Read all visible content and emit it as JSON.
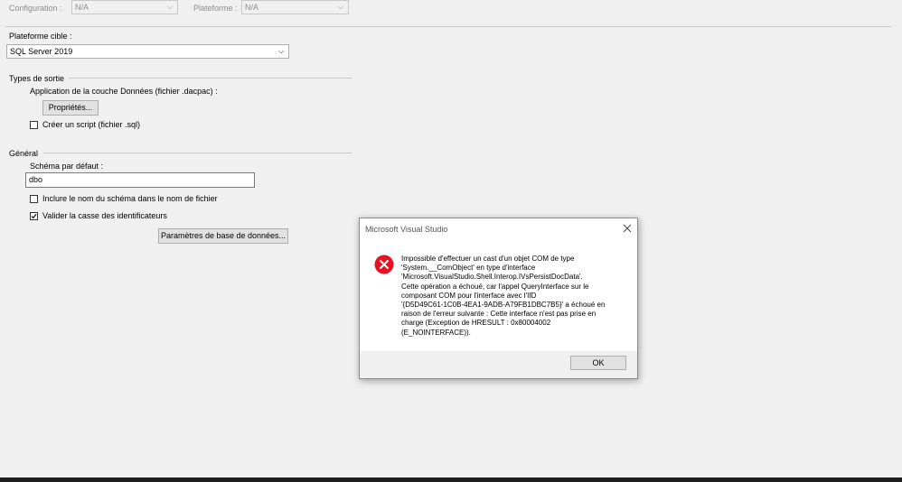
{
  "toolbar": {
    "configuration_label": "Configuration :",
    "configuration_value": "N/A",
    "platform_label": "Plateforme :",
    "platform_value": "N/A"
  },
  "target_platform": {
    "label": "Plateforme cible :",
    "value": "SQL Server 2019"
  },
  "output_types": {
    "group_label": "Types de sortie",
    "dacpac_label": "Application de la couche Données (fichier .dacpac) :",
    "properties_button": "Propriétés...",
    "create_script_label": "Créer un script (fichier .sql)",
    "create_script_checked": false
  },
  "general": {
    "group_label": "Général",
    "default_schema_label": "Schéma par défaut :",
    "default_schema_value": "dbo",
    "include_schema_label": "Inclure le nom du schéma dans le nom de fichier",
    "include_schema_checked": false,
    "validate_casing_label": "Valider la casse des identificateurs",
    "validate_casing_checked": true,
    "db_settings_button": "Paramètres de base de données..."
  },
  "dialog": {
    "title": "Microsoft Visual Studio",
    "message_lines": [
      "Impossible d'effectuer un cast d'un objet COM de type",
      "'System.__ComObject' en type d'interface",
      "'Microsoft.VisualStudio.Shell.Interop.IVsPersistDocData'.",
      "Cette opération a échoué, car l'appel QueryInterface sur le",
      "composant COM pour l'interface avec l'IID",
      "'{D5D49C61-1C0B-4EA1-9ADB-A79FB1DBC7B5}' a échoué en",
      "raison de l'erreur suivante : Cette interface n'est pas prise en",
      "charge (Exception de HRESULT : 0x80004002",
      "(E_NOINTERFACE))."
    ],
    "ok_button": "OK",
    "icon": "error-icon",
    "close_icon": "close-icon"
  },
  "colors": {
    "background": "#f0f0f0",
    "error_red": "#e81123",
    "dialog_background": "#ffffff",
    "ok_border": "#adadad"
  }
}
